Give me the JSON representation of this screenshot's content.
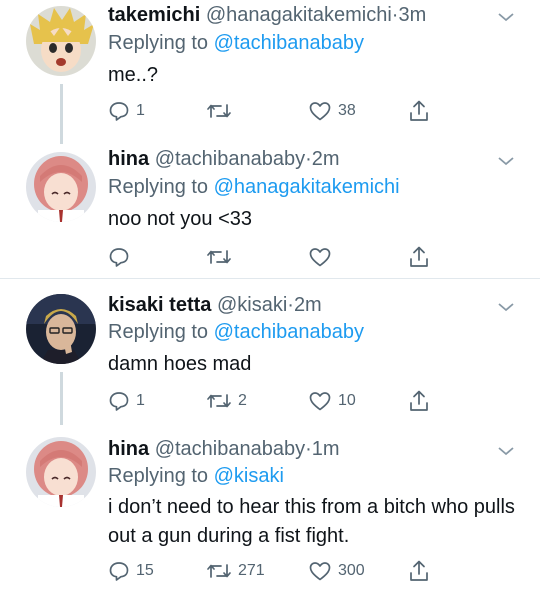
{
  "tweets": [
    {
      "name": "takemichi",
      "handle": "@hanagakitakemichi",
      "dot": "·",
      "time": "3m",
      "replying_prefix": "Replying to ",
      "replying_to": "@tachibanababy",
      "text": "me..?",
      "counts": {
        "reply": "1",
        "retweet": "",
        "like": "38"
      }
    },
    {
      "name": "hina",
      "handle": "@tachibanababy",
      "dot": "·",
      "time": "2m",
      "replying_prefix": "Replying to ",
      "replying_to": "@hanagakitakemichi",
      "text": "noo not you <33",
      "counts": {
        "reply": "",
        "retweet": "",
        "like": ""
      }
    },
    {
      "name": "kisaki tetta",
      "handle": "@kisaki",
      "dot": "·",
      "time": "2m",
      "replying_prefix": "Replying to ",
      "replying_to": "@tachibanababy",
      "text": "damn hoes mad",
      "counts": {
        "reply": "1",
        "retweet": "2",
        "like": "10"
      }
    },
    {
      "name": "hina",
      "handle": "@tachibanababy",
      "dot": "·",
      "time": "1m",
      "replying_prefix": "Replying to ",
      "replying_to": "@kisaki",
      "text": "i don’t need to hear this from a bitch who pulls out a gun during a fist fight.",
      "counts": {
        "reply": "15",
        "retweet": "271",
        "like": "300"
      }
    }
  ],
  "icons": {
    "reply": "reply-icon",
    "retweet": "retweet-icon",
    "like": "heart-icon",
    "share": "share-icon",
    "more": "chevron-down-icon"
  },
  "colors": {
    "link": "#1d9bf0",
    "muted": "#536471",
    "text": "#0f1419",
    "thread_line": "#cfd9de",
    "divider": "#e1e8ed"
  }
}
